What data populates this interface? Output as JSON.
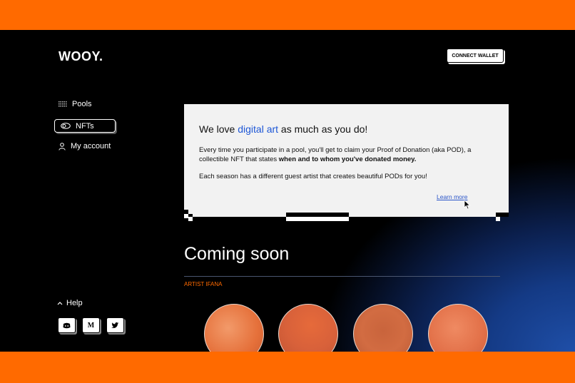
{
  "brand": {
    "logo": "WOOY."
  },
  "header": {
    "connect_wallet": "CONNECT WALLET"
  },
  "sidebar": {
    "items": [
      {
        "label": "Pools",
        "icon": "grid-icon"
      },
      {
        "label": "NFTs",
        "icon": "coins-icon",
        "active": true
      },
      {
        "label": "My account",
        "icon": "user-icon"
      }
    ],
    "help": "Help",
    "social": [
      "discord-icon",
      "medium-icon",
      "twitter-icon"
    ],
    "social_labels": {
      "medium": "M"
    }
  },
  "info_card": {
    "title_pre": "We love ",
    "title_highlight": "digital art",
    "title_post": " as much as you do!",
    "para1_text": "Every time you participate in a pool, you'll get to claim your Proof of Donation (aka POD), a collectible NFT that states ",
    "para1_bold": "when and to whom you've donated money.",
    "para2": "Each season has a different guest artist that creates beautiful PODs for you!",
    "learn_more": "Learn more"
  },
  "main": {
    "coming_soon": "Coming soon",
    "artist_label": "ARTIST IFANA"
  },
  "colors": {
    "accent": "#ff6a00",
    "highlight": "#1e57d6",
    "link": "#2a55c9"
  }
}
